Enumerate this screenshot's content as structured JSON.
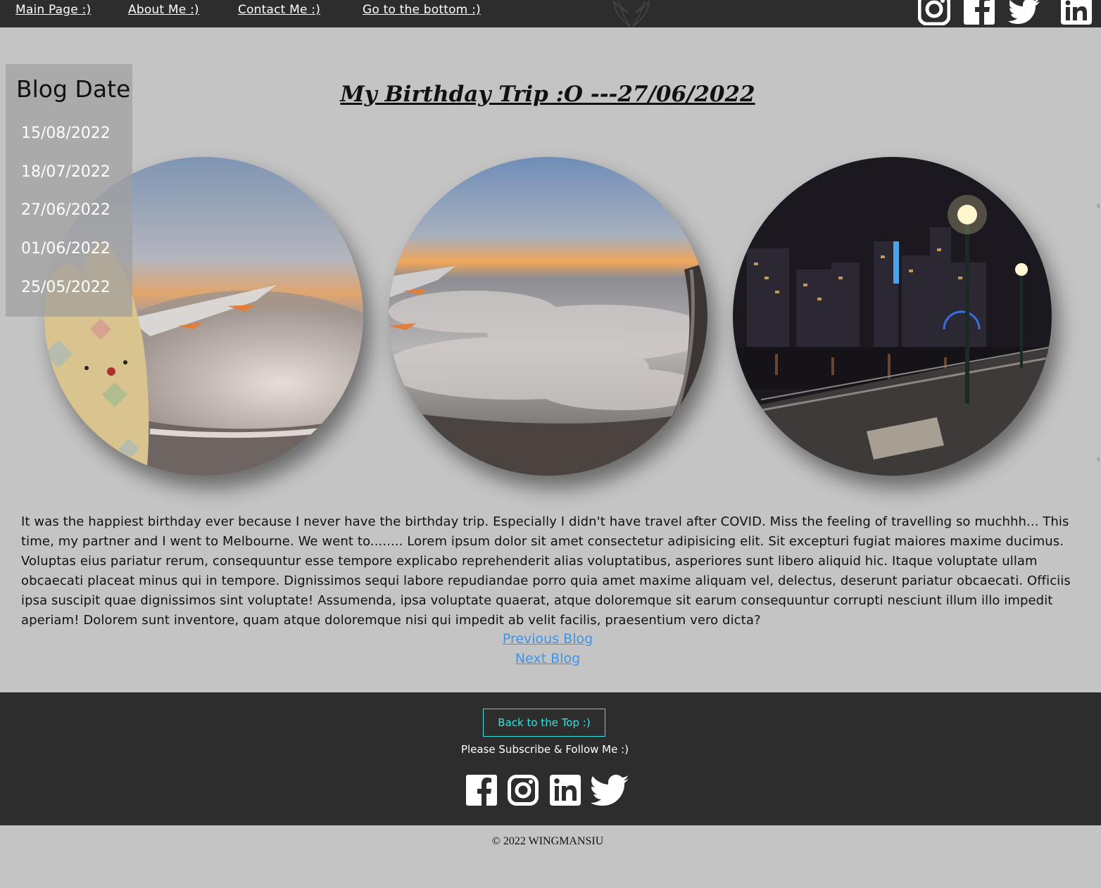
{
  "nav": {
    "links": [
      "Main Page :)",
      "About Me :)",
      "Contact Me :)",
      "Go to the bottom :)"
    ]
  },
  "sidebar": {
    "title": "Blog Date",
    "dates": [
      "15/08/2022",
      "18/07/2022",
      "27/06/2022",
      "01/06/2022",
      "25/05/2022"
    ]
  },
  "blog": {
    "title": "My Birthday Trip :O ---27/06/2022",
    "text": "It was the happiest birthday ever because I never have the birthday trip. Especially I didn't have travel after COVID. Miss the feeling of travelling so muchhh... This time, my partner and I went to Melbourne. We went to........ Lorem ipsum dolor sit amet consectetur adipisicing elit. Sit excepturi fugiat maiores maxime ducimus. Voluptas eius pariatur rerum, consequuntur esse tempore explicabo reprehenderit alias voluptatibus, asperiores sunt libero aliquid hic. Itaque voluptate ullam obcaecati placeat minus qui in tempore. Dignissimos sequi labore repudiandae porro quia amet maxime aliquam vel, delectus, deserunt pariatur obcaecati. Officiis ipsa suscipit quae dignissimos sint voluptate! Assumenda, ipsa voluptate quaerat, atque doloremque sit earum consequuntur corrupti nesciunt illum illo impedit aperiam! Dolorem sunt inventore, quam atque doloremque nisi qui impedit ab velit facilis, praesentium vero dicta?",
    "previous_label": "Previous Blog",
    "next_label": "Next Blog"
  },
  "footer": {
    "back_to_top": "Back to the Top :)",
    "subscribe": "Please Subscribe & Follow Me :)",
    "copyright": "© 2022 WINGMANSIU"
  },
  "icons": {
    "top": [
      "instagram-icon",
      "facebook-icon",
      "twitter-icon",
      "linkedin-icon"
    ],
    "footer": [
      "facebook-icon",
      "instagram-icon",
      "linkedin-icon",
      "twitter-icon"
    ]
  },
  "colors": {
    "page_bg": "#c4c4c4",
    "bar_bg": "#2d2d2d",
    "link_blue": "#3f93e8",
    "button_cyan": "#2ee6e6"
  }
}
